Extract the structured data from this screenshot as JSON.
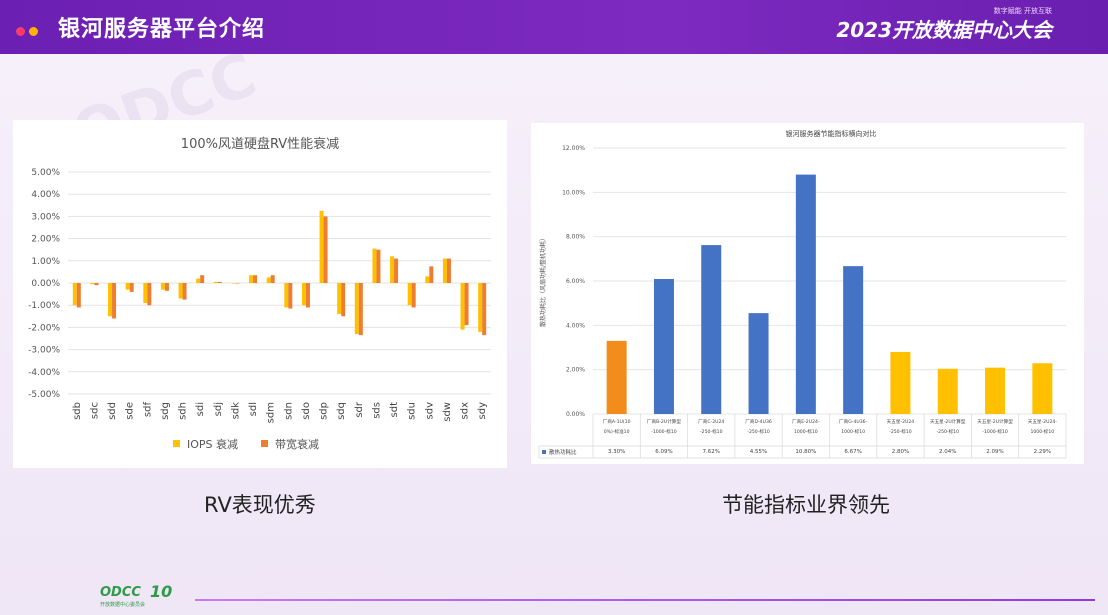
{
  "header": {
    "title": "银河服务器平台介绍",
    "brand": "2023开放数据中心大会",
    "brand_tagline": "数字赋能 开放互联",
    "dot_colors": [
      "#ff3b6b",
      "#ffb300"
    ]
  },
  "left_caption": "RV表现优秀",
  "right_caption": "节能指标业界领先",
  "footer": {
    "logo": "ODCC",
    "logo_number": "10",
    "logo_sub": "开放数据中心委员会"
  },
  "watermark": "ODCC",
  "chart_data": [
    {
      "type": "bar",
      "title": "100%风道硬盘RV性能衰减",
      "categories": [
        "sdb",
        "sdc",
        "sdd",
        "sde",
        "sdf",
        "sdg",
        "sdh",
        "sdi",
        "sdj",
        "sdk",
        "sdl",
        "sdm",
        "sdn",
        "sdo",
        "sdp",
        "sdq",
        "sdr",
        "sds",
        "sdt",
        "sdu",
        "sdv",
        "sdw",
        "sdx",
        "sdy"
      ],
      "series": [
        {
          "name": "IOPS 衰减",
          "color": "#ffc000",
          "values": [
            -1.0,
            -0.05,
            -1.5,
            -0.3,
            -0.9,
            -0.3,
            -0.7,
            0.2,
            0.05,
            0,
            0.35,
            0.25,
            -1.1,
            -1.0,
            3.25,
            -1.4,
            -2.3,
            1.55,
            1.2,
            -1.0,
            0.3,
            1.1,
            -2.1,
            -2.2
          ]
        },
        {
          "name": "带宽衰减",
          "color": "#ed7d31",
          "values": [
            -1.1,
            -0.1,
            -1.6,
            -0.4,
            -1.0,
            -0.35,
            -0.75,
            0.35,
            0.05,
            0,
            0.35,
            0.35,
            -1.15,
            -1.1,
            3.0,
            -1.5,
            -2.35,
            1.5,
            1.1,
            -1.1,
            0.75,
            1.1,
            -1.9,
            -2.35
          ]
        }
      ],
      "yticks": [
        "5.00%",
        "4.00%",
        "3.00%",
        "2.00%",
        "1.00%",
        "0.00%",
        "-1.00%",
        "-2.00%",
        "-3.00%",
        "-4.00%",
        "-5.00%"
      ],
      "ylim": [
        -5,
        5
      ],
      "legend": "bottom",
      "grid": true
    },
    {
      "type": "bar",
      "title": "银河服务器节能指标横向对比",
      "ylabel": "散热功耗比（风扇功耗/整机功耗）",
      "categories": [
        "厂商A-1U(100%)-标准10",
        "厂商B-2U计算型-1000-标10",
        "厂商C-2U24-250-标10",
        "厂商D-4U36-250-标10",
        "厂商E-2U24-1000-标10",
        "厂商G-4U36-1000-标10",
        "天五星-2U24-250-标10",
        "天五星-2U计算型-250-标10",
        "天五星-2U计算型-1000-标10",
        "天五星-2U24-1000-标10"
      ],
      "series": [
        {
          "name": "散热功耗比",
          "values": [
            3.3,
            6.09,
            7.62,
            4.55,
            10.8,
            6.67,
            2.8,
            2.04,
            2.09,
            2.29
          ],
          "labels": [
            "3.30%",
            "6.09%",
            "7.62%",
            "4.55%",
            "10.80%",
            "6.67%",
            "2.80%",
            "2.04%",
            "2.09%",
            "2.29%"
          ]
        }
      ],
      "bar_colors": [
        "#f28c1c",
        "#4472c4",
        "#4472c4",
        "#4472c4",
        "#4472c4",
        "#4472c4",
        "#ffc000",
        "#ffc000",
        "#ffc000",
        "#ffc000"
      ],
      "yticks": [
        "12.00%",
        "10.00%",
        "8.00%",
        "6.00%",
        "4.00%",
        "2.00%",
        "0.00%"
      ],
      "ylim": [
        0,
        12
      ],
      "grid": true,
      "legend": "table-left"
    }
  ]
}
